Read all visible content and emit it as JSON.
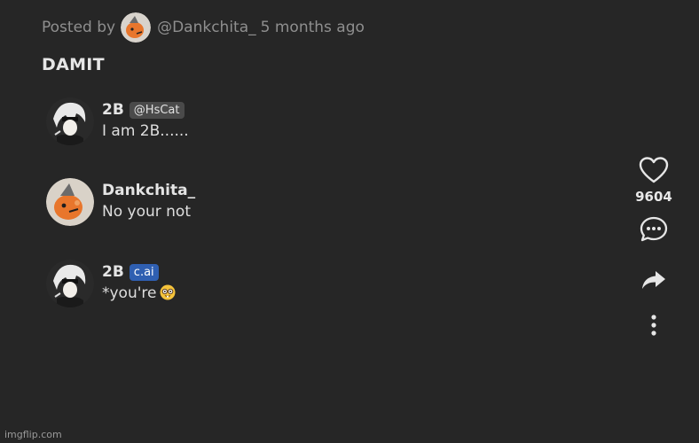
{
  "post": {
    "posted_by_label": "Posted by",
    "author_handle": "@Dankchita_",
    "time_ago": "5 months ago",
    "title": "DAMIT"
  },
  "messages": [
    {
      "name": "2B",
      "tag": "@HsCat",
      "text": "I am 2B......",
      "avatar": "2b-avatar"
    },
    {
      "name": "Dankchita_",
      "text": "No your not",
      "avatar": "dankchita-avatar"
    },
    {
      "name": "2B",
      "tag": "c.ai",
      "text": "*you're",
      "emoji": "nerd-face-emoji",
      "avatar": "2b-avatar"
    }
  ],
  "actions": {
    "like_count": "9604",
    "icons": [
      "heart-icon",
      "comment-icon",
      "share-icon",
      "more-vertical-icon"
    ]
  },
  "watermark": "imgflip.com",
  "colors": {
    "background": "#262626",
    "muted_text": "#8f8f8f",
    "cai_badge": "#2f5fb1",
    "creator_badge": "#4a4a4a"
  }
}
